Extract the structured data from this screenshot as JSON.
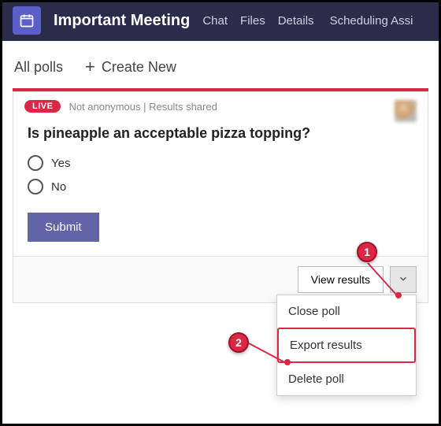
{
  "topbar": {
    "title": "Important Meeting",
    "tabs": [
      "Chat",
      "Files",
      "Details",
      "Scheduling Assi"
    ]
  },
  "subbar": {
    "all_polls": "All polls",
    "create_new": "Create New"
  },
  "poll": {
    "live_badge": "LIVE",
    "meta": "Not anonymous | Results shared",
    "question": "Is pineapple an acceptable pizza topping?",
    "options": [
      "Yes",
      "No"
    ],
    "submit": "Submit"
  },
  "footer": {
    "view_results": "View results"
  },
  "dropdown": {
    "items": [
      "Close poll",
      "Export results",
      "Delete poll"
    ]
  },
  "callouts": {
    "one": "1",
    "two": "2"
  },
  "colors": {
    "accent": "#d92846",
    "primary": "#6264a7",
    "topbar": "#2b2b4a"
  }
}
